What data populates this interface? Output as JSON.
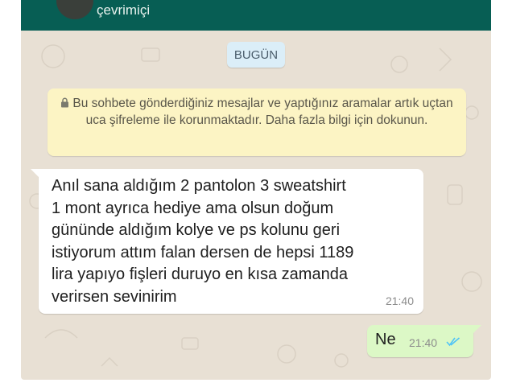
{
  "header": {
    "status": "çevrimiçi"
  },
  "date_chip": "BUGÜN",
  "encryption_notice": {
    "text": "Bu sohbete gönderdiğiniz mesajlar ve yaptığınız aramalar artık uçtan uca şifreleme ile korunmaktadır. Daha fazla bilgi için dokunun.",
    "icon": "lock-icon"
  },
  "messages": [
    {
      "direction": "incoming",
      "text": "Anıl sana aldığım 2 pantolon 3 sweatshirt\n1 mont ayrıca hediye ama olsun doğum\ngününde aldığım kolye ve ps kolunu geri\nistiyorum attım falan dersen de hepsi 1189\nlira yapıyo fişleri duruyo en kısa zamanda\nverirsen sevinirim",
      "time": "21:40"
    },
    {
      "direction": "outgoing",
      "text": "Ne",
      "time": "21:40",
      "status_icon": "double-check-icon"
    }
  ],
  "colors": {
    "header": "#075e54",
    "chat_background": "#e8e0d4",
    "incoming_bubble": "#ffffff",
    "outgoing_bubble": "#dcf8c6",
    "notice_background": "#fcf4c4",
    "date_chip_background": "#dbeef8",
    "read_ticks": "#4fc3f7"
  }
}
